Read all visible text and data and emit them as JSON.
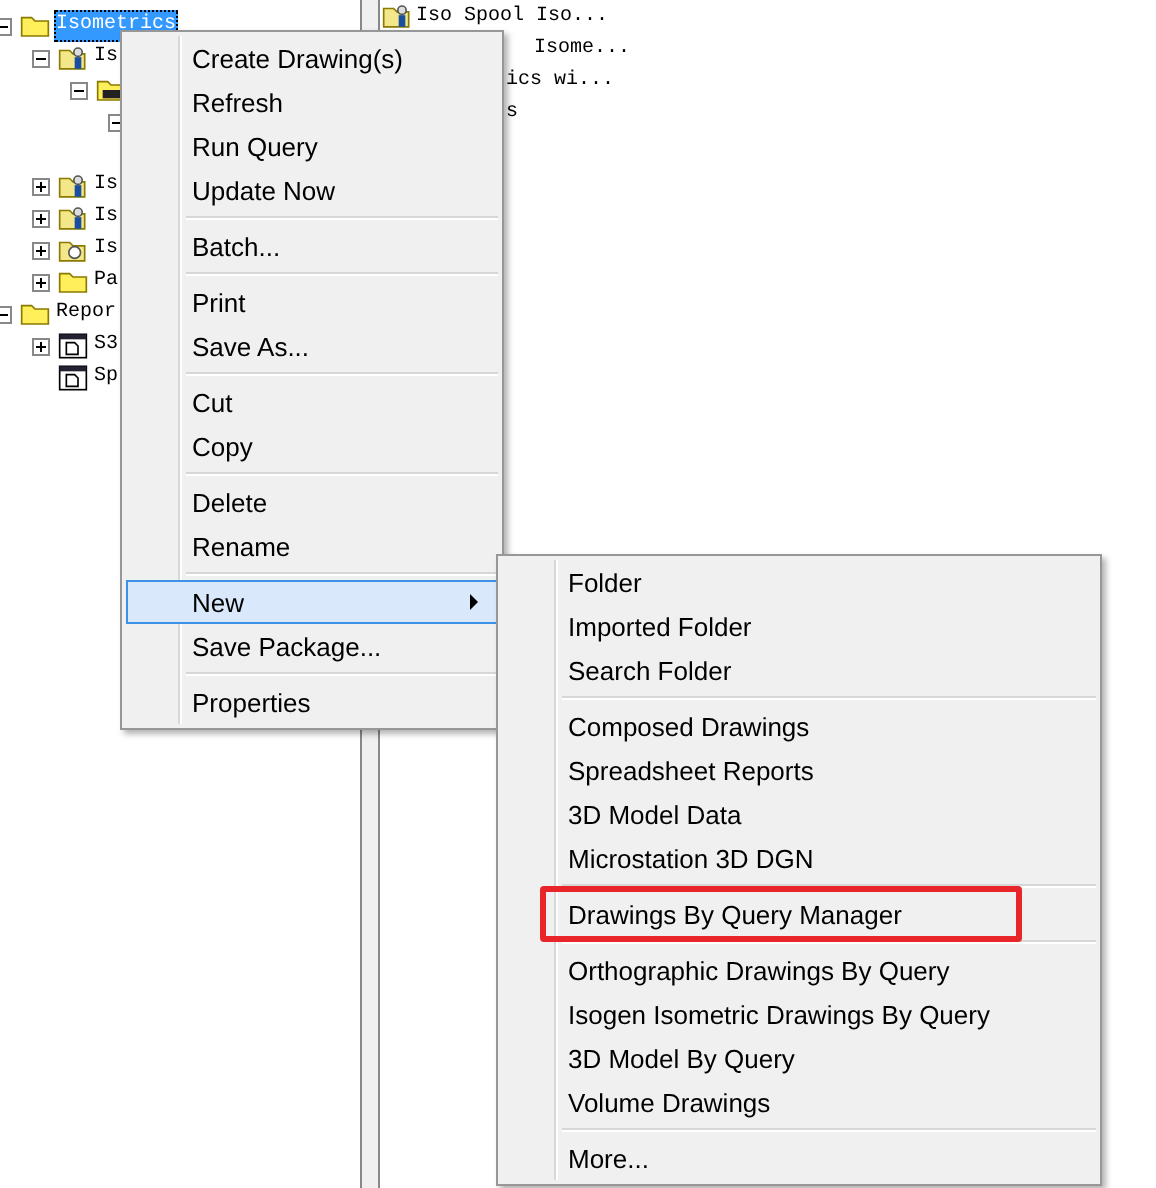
{
  "tree": [
    {
      "label": "Isometrics",
      "kind": "folder",
      "expanded": true,
      "selected": true,
      "children": [
        {
          "label": "Is",
          "kind": "folder-person",
          "expanded": true,
          "selected": false,
          "children": [
            {
              "kind": "folder-dark",
              "expanded": true,
              "children": [
                {
                  "expanded": true
                }
              ]
            }
          ]
        },
        {
          "label": "Is",
          "kind": "folder-person",
          "expanded": false,
          "selected": false
        },
        {
          "label": "Is",
          "kind": "folder-person",
          "expanded": false,
          "selected": false
        },
        {
          "label": "Is",
          "kind": "folder-search",
          "expanded": false,
          "selected": false
        },
        {
          "label": "Pa",
          "kind": "folder",
          "expanded": false,
          "selected": false
        }
      ]
    },
    {
      "label": "Repor",
      "kind": "folder",
      "expanded": true,
      "selected": false,
      "children": [
        {
          "label": "S3",
          "kind": "document",
          "expanded": false,
          "selected": false
        },
        {
          "label": "Sp",
          "kind": "document",
          "selected": false
        }
      ]
    }
  ],
  "list": [
    {
      "label": "Iso Spool Iso...",
      "kind": "folder-person"
    },
    {
      "label": "Isome..."
    },
    {
      "label": "ics wi..."
    },
    {
      "label": "s"
    }
  ],
  "context_menu": {
    "groups": [
      [
        {
          "label": "Create Drawing(s)",
          "selected": false,
          "submenu": false
        },
        {
          "label": "Refresh",
          "selected": false,
          "submenu": false
        },
        {
          "label": "Run Query",
          "selected": false,
          "submenu": false
        },
        {
          "label": "Update Now",
          "selected": false,
          "submenu": false
        }
      ],
      [
        {
          "label": "Batch...",
          "selected": false,
          "submenu": false
        }
      ],
      [
        {
          "label": "Print",
          "selected": false,
          "submenu": false
        },
        {
          "label": "Save As...",
          "selected": false,
          "submenu": false
        }
      ],
      [
        {
          "label": "Cut",
          "selected": false,
          "submenu": false
        },
        {
          "label": "Copy",
          "selected": false,
          "submenu": false
        }
      ],
      [
        {
          "label": "Delete",
          "selected": false,
          "submenu": false
        },
        {
          "label": "Rename",
          "selected": false,
          "submenu": false
        }
      ],
      [
        {
          "label": "New",
          "selected": true,
          "submenu": true
        },
        {
          "label": "Save Package...",
          "selected": false,
          "submenu": false
        }
      ],
      [
        {
          "label": "Properties",
          "selected": false,
          "submenu": false
        }
      ]
    ]
  },
  "submenu": {
    "groups": [
      [
        {
          "label": "Folder",
          "highlighted": false
        },
        {
          "label": "Imported Folder",
          "highlighted": false
        },
        {
          "label": "Search Folder",
          "highlighted": false
        }
      ],
      [
        {
          "label": "Composed Drawings",
          "highlighted": false
        },
        {
          "label": "Spreadsheet Reports",
          "highlighted": false
        },
        {
          "label": "3D Model Data",
          "highlighted": false
        },
        {
          "label": "Microstation 3D DGN",
          "highlighted": false
        }
      ],
      [
        {
          "label": "Drawings By Query Manager",
          "highlighted": true
        }
      ],
      [
        {
          "label": "Orthographic Drawings By Query",
          "highlighted": false
        },
        {
          "label": "Isogen Isometric Drawings By Query",
          "highlighted": false
        },
        {
          "label": "3D Model By Query",
          "highlighted": false
        },
        {
          "label": "Volume Drawings",
          "highlighted": false
        }
      ],
      [
        {
          "label": "More...",
          "highlighted": false
        }
      ]
    ]
  }
}
